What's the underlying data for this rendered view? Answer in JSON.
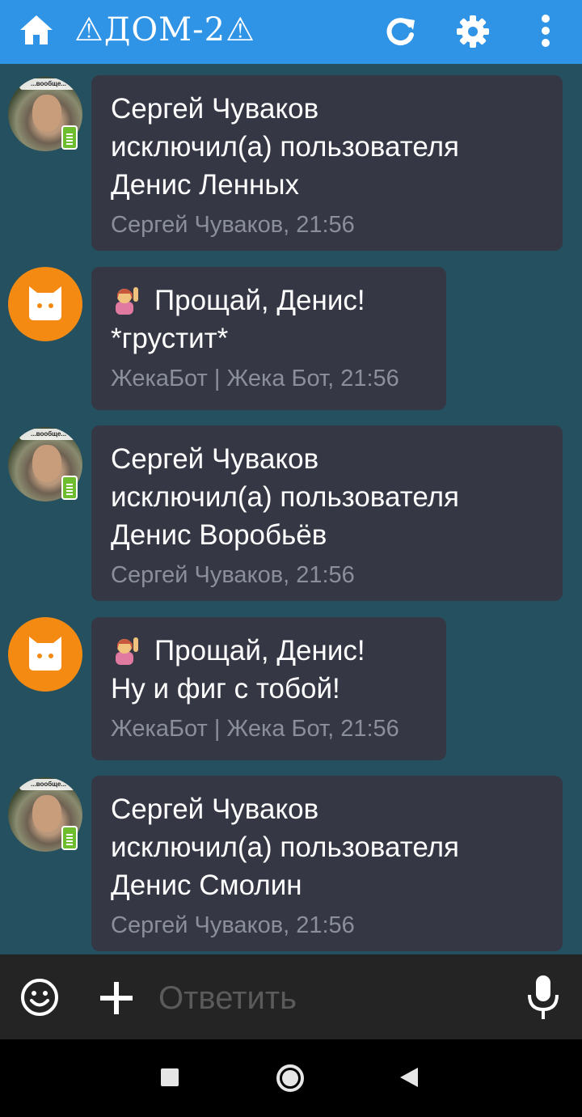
{
  "header": {
    "title": "⚠ДОМ-2⚠",
    "home_icon": "home-icon",
    "refresh_icon": "refresh-icon",
    "settings_icon": "gear-icon",
    "more_icon": "more-vertical-icon"
  },
  "messages": [
    {
      "sender_type": "user",
      "avatar_caption": "...вообще...",
      "lines": [
        "Сергей Чуваков",
        "исключил(а) пользователя",
        "Денис Ленных"
      ],
      "meta": "Сергей Чуваков, 21:56"
    },
    {
      "sender_type": "bot",
      "lines": [
        "Прощай, Денис!",
        "*грустит*"
      ],
      "meta": "ЖекаБот | Жека Бот, 21:56"
    },
    {
      "sender_type": "user",
      "avatar_caption": "...вообще...",
      "lines": [
        "Сергей Чуваков",
        "исключил(а) пользователя",
        "Денис Воробьёв"
      ],
      "meta": "Сергей Чуваков, 21:56"
    },
    {
      "sender_type": "bot",
      "lines": [
        "Прощай, Денис!",
        "Ну и фиг с тобой!"
      ],
      "meta": "ЖекаБот | Жека Бот, 21:56"
    },
    {
      "sender_type": "user",
      "avatar_caption": "...вообще...",
      "lines": [
        "Сергей Чуваков",
        "исключил(а) пользователя",
        "Денис Смолин"
      ],
      "meta": "Сергей Чуваков, 21:56"
    }
  ],
  "composer": {
    "placeholder": "Ответить",
    "emoji_icon": "smiley-icon",
    "attach_icon": "plus-icon",
    "mic_icon": "microphone-icon"
  },
  "colors": {
    "topbar": "#2f93e6",
    "background": "#24505f",
    "bubble": "#353844",
    "meta_text": "#8b8f9b",
    "bot_avatar": "#f58a12",
    "phone_badge": "#6ebd2f"
  }
}
